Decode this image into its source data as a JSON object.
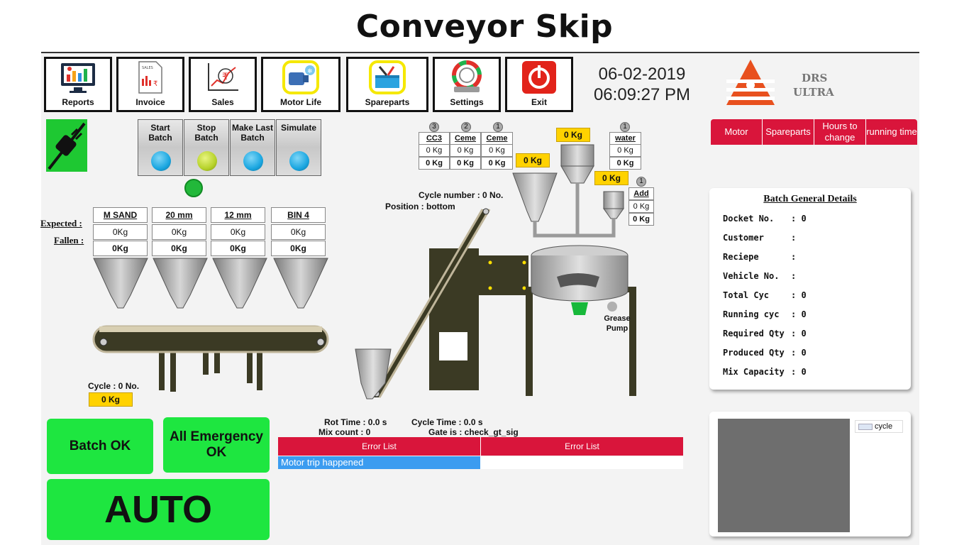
{
  "title": "Conveyor Skip",
  "toolbar": [
    {
      "label": "Reports",
      "icon": "monitor-chart-icon"
    },
    {
      "label": "Invoice",
      "icon": "invoice-icon"
    },
    {
      "label": "Sales",
      "icon": "sales-chart-icon"
    },
    {
      "label": "Motor Life",
      "icon": "motor-icon"
    },
    {
      "label": "Spareparts",
      "icon": "toolbox-icon"
    },
    {
      "label": "Settings",
      "icon": "gear-icon"
    },
    {
      "label": "Exit",
      "icon": "power-icon"
    }
  ],
  "datetime": {
    "date": "06-02-2019",
    "time": "06:09:27 PM"
  },
  "logo": {
    "line1": "DRS",
    "line2": "ULTRA"
  },
  "right_tabs": [
    "Motor",
    "Spareparts",
    "Hours to change",
    "running time"
  ],
  "batch_buttons": [
    {
      "label": "Start Batch",
      "color": "#1aa6e0"
    },
    {
      "label": "Stop Batch",
      "color": "#b6d22a"
    },
    {
      "label": "Make Last Batch",
      "color": "#1aa6e0"
    },
    {
      "label": "Simulate",
      "color": "#1aa6e0"
    }
  ],
  "bins": {
    "expected_label": "Expected :",
    "fallen_label": "Fallen :",
    "items": [
      {
        "name": "M SAND",
        "expected": "0Kg",
        "fallen": "0Kg"
      },
      {
        "name": "20 mm",
        "expected": "0Kg",
        "fallen": "0Kg"
      },
      {
        "name": "12 mm",
        "expected": "0Kg",
        "fallen": "0Kg"
      },
      {
        "name": "BIN 4",
        "expected": "0Kg",
        "fallen": "0Kg"
      }
    ]
  },
  "conveyor": {
    "cycle_label": "Cycle  : 0 No.",
    "cycle_value": "0 Kg"
  },
  "cement": {
    "items": [
      {
        "num": "3",
        "name": "CC3",
        "expected": "0 Kg",
        "fallen": "0 Kg"
      },
      {
        "num": "2",
        "name": "Ceme",
        "expected": "0 Kg",
        "fallen": "0 Kg"
      },
      {
        "num": "1",
        "name": "Ceme",
        "expected": "0 Kg",
        "fallen": "0 Kg"
      }
    ],
    "hopper_value": "0 Kg"
  },
  "water": {
    "num": "1",
    "name": "water",
    "expected": "0 Kg",
    "fallen": "0 Kg",
    "hopper_value": "0 Kg"
  },
  "additive": {
    "num": "1",
    "name": "Add",
    "expected": "0 Kg",
    "fallen": "0 Kg",
    "hopper_value": "0 Kg"
  },
  "skip": {
    "cycle_number": "Cycle number : 0 No.",
    "position": "Position : bottom"
  },
  "grease_pump": "Grease Pump",
  "stats": {
    "rot_time": "Rot Time : 0.0 s",
    "mix_count": "Mix count : 0",
    "cycle_time": "Cycle Time : 0.0 s",
    "gate": "Gate is : check_gt_sig"
  },
  "errors": {
    "headers": [
      "Error List",
      "Error List"
    ],
    "rows": [
      [
        "Motor trip happened",
        ""
      ]
    ]
  },
  "buttons": {
    "batch_ok": "Batch OK",
    "all_emergency_ok": "All Emergency OK",
    "auto": "AUTO"
  },
  "details": {
    "title": "Batch General Details",
    "rows": [
      {
        "key": "Docket No.",
        "sep": ":",
        "value": "0"
      },
      {
        "key": "Customer",
        "sep": ":",
        "value": ""
      },
      {
        "key": "Reciepe",
        "sep": ":",
        "value": ""
      },
      {
        "key": "Vehicle No.",
        "sep": ":",
        "value": ""
      },
      {
        "key": "Total Cyc",
        "sep": ":",
        "value": "0"
      },
      {
        "key": "Running cyc",
        "sep": ":",
        "value": "0"
      },
      {
        "key": "Required Qty",
        "sep": ":",
        "value": "0"
      },
      {
        "key": "Produced Qty",
        "sep": ":",
        "value": "0"
      },
      {
        "key": "Mix Capacity",
        "sep": ":",
        "value": "0"
      }
    ]
  },
  "chart_legend": "cycle",
  "colors": {
    "accent_red": "#d9153b",
    "ok_green": "#1ee640",
    "value_yellow": "#ffd200",
    "error_blue": "#3b9cf0"
  }
}
